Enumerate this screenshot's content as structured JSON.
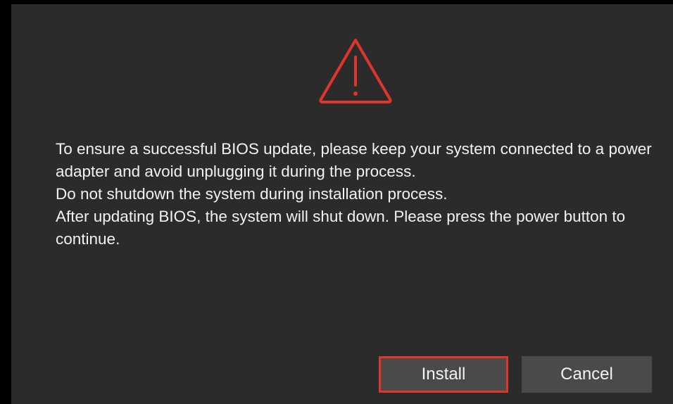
{
  "dialog": {
    "icon": "warning-triangle-icon",
    "accent_color": "#e0352b",
    "messages": [
      "To ensure a successful BIOS update, please keep your system connected to a power adapter and avoid unplugging it during the process.",
      "Do not shutdown the system during installation process.",
      "After updating BIOS, the system will shut down. Please press the power button to continue."
    ],
    "buttons": {
      "install_label": "Install",
      "cancel_label": "Cancel"
    }
  }
}
